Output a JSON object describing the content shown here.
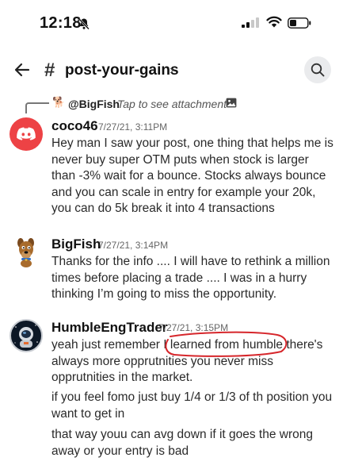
{
  "status": {
    "time": "12:18"
  },
  "header": {
    "hash": "#",
    "channel": "post-your-gains",
    "chevron": "›"
  },
  "reply": {
    "avatar": "🐕",
    "name": "@BigFish",
    "tap": "Tap to see attachment"
  },
  "messages": [
    {
      "author": "coco46",
      "time": "7/27/21, 3:11PM",
      "lines": [
        "Hey man I saw your post, one thing that helps me is never buy super OTM puts when stock is larger than -3% wait for a bounce. Stocks always bounce and you can scale in entry for example your 20k, you can do 5k break it into 4 transactions"
      ]
    },
    {
      "author": "BigFish",
      "time": "7/27/21, 3:14PM",
      "lines": [
        "Thanks for the info .... I will have to rethink a million times before placing a trade .... I was in a hurry thinking I’m going to miss the opportunity."
      ]
    },
    {
      "author": "HumbleEngTrader",
      "time": "7/27/21, 3:15PM",
      "lines": [
        "yeah just remember I learned from humble there's always more opprutnities you never miss opprutnities in the market.",
        "if you feel fomo just buy 1/4 or 1/3 of th position you want to get in",
        "that way youu can avg down if it goes the wrong away or your entry is bad"
      ]
    }
  ],
  "colors": {
    "discord_red": "#ed4245",
    "annotation_red": "#d6262b"
  },
  "icons": [
    "bell-slash-icon",
    "signal-icon",
    "wifi-icon",
    "battery-icon",
    "back-arrow-icon",
    "search-icon",
    "image-icon",
    "discord-logo-icon"
  ]
}
